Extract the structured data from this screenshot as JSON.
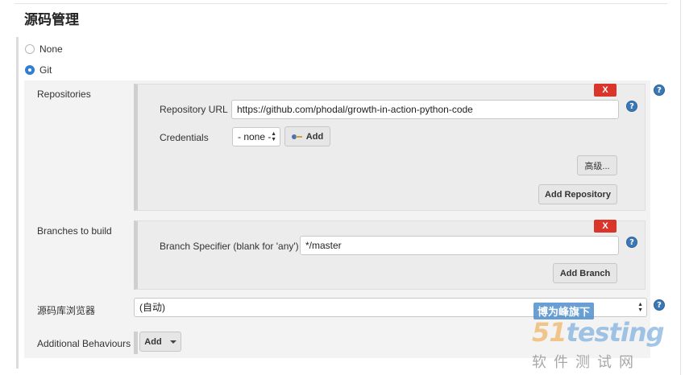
{
  "section": {
    "title": "源码管理"
  },
  "scm_options": {
    "none_label": "None",
    "git_label": "Git",
    "selected": "Git"
  },
  "repositories": {
    "label": "Repositories",
    "delete_label": "X",
    "url_label": "Repository URL",
    "url_value": "https://github.com/phodal/growth-in-action-python-code",
    "credentials_label": "Credentials",
    "credentials_selected": "- none -",
    "add_credentials_label": "Add",
    "advanced_label": "高级...",
    "add_repository_label": "Add Repository"
  },
  "branches": {
    "label": "Branches to build",
    "delete_label": "X",
    "specifier_label": "Branch Specifier (blank for 'any')",
    "specifier_value": "*/master",
    "add_branch_label": "Add Branch"
  },
  "browser": {
    "label": "源码库浏览器",
    "selected": "(自动)"
  },
  "behaviours": {
    "label": "Additional Behaviours",
    "add_label": "Add"
  },
  "help_glyph": "?",
  "watermark": {
    "badge": "博为峰旗下",
    "logo_num": "51",
    "logo_text": "testing",
    "subtitle": "软件测试网"
  },
  "colors": {
    "accent": "#2f7fd6",
    "delete": "#d9352b",
    "help": "#3a78b5"
  }
}
